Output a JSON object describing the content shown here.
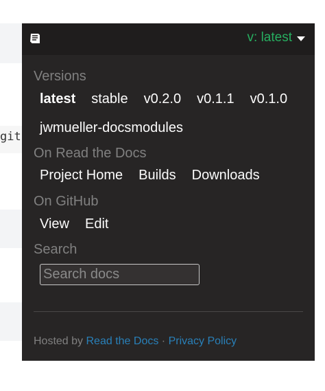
{
  "background": {
    "code_fragment": "git"
  },
  "header": {
    "current_version": "v: latest",
    "book_icon": "book-icon",
    "caret_icon": "caret-down-icon",
    "accent_color": "#27ae60"
  },
  "versions": {
    "title": "Versions",
    "items": [
      {
        "label": "latest",
        "active": true
      },
      {
        "label": "stable"
      },
      {
        "label": "v0.2.0"
      },
      {
        "label": "v0.1.1"
      },
      {
        "label": "v0.1.0"
      }
    ],
    "extra_item": "jwmueller-docsmodules"
  },
  "rtd": {
    "title": "On Read the Docs",
    "items": [
      {
        "label": "Project Home"
      },
      {
        "label": "Builds"
      },
      {
        "label": "Downloads"
      }
    ]
  },
  "github": {
    "title": "On GitHub",
    "items": [
      {
        "label": "View"
      },
      {
        "label": "Edit"
      }
    ]
  },
  "search": {
    "title": "Search",
    "placeholder": "Search docs"
  },
  "footer": {
    "hosted_by": "Hosted by",
    "rtd_link": "Read the Docs",
    "separator": "·",
    "privacy_link": "Privacy Policy",
    "link_color": "#2980b9"
  }
}
